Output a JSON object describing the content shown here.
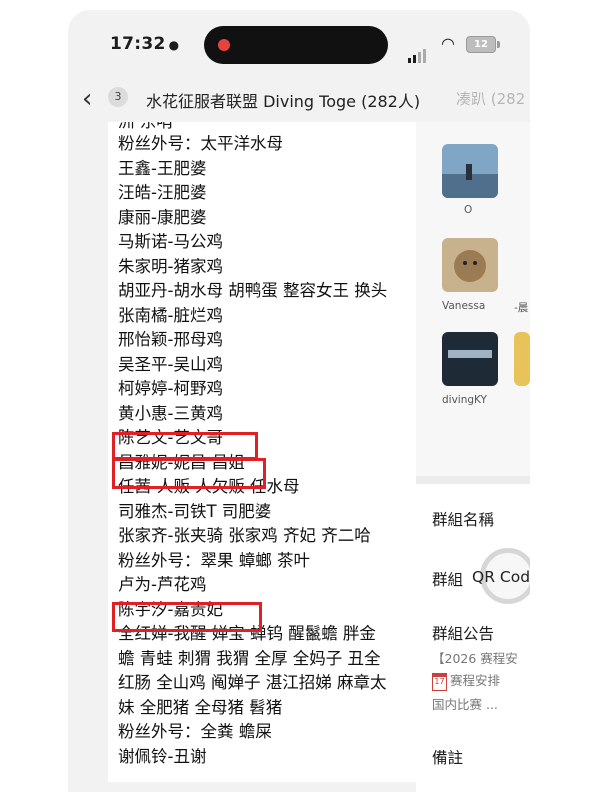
{
  "status": {
    "time": "17:32",
    "battery": "12"
  },
  "header": {
    "back_count": "3",
    "title": "水花征服者联盟 Diving Toge (282人)",
    "overflow": "凑趴 (282"
  },
  "chat": {
    "top_line": "洲 东哨",
    "lines": [
      "粉丝外号：太平洋水母",
      "王鑫-王肥婆",
      "汪皓-汪肥婆",
      "康丽-康肥婆",
      "马斯诺-马公鸡",
      "朱家明-猪家鸡",
      "胡亚丹-胡水母 胡鸭蛋 整容女王 换头",
      "张南橘-脏烂鸡",
      "邢怡颖-邢母鸡",
      "吴圣平-吴山鸡",
      "柯婷婷-柯野鸡",
      "黄小惠-三黄鸡",
      "陈艺文-艺文哥",
      "昌雅妮-妮昌 昌姐",
      "任茜-人贩 人欠贩 任水母",
      "司雅杰-司铁T 司肥婆",
      "张家齐-张夹骑 张家鸡 齐妃 齐二哈",
      "粉丝外号：翠果 蟑螂 茶叶",
      "卢为-芦花鸡",
      "陈宇汐-嘉贵妃",
      "全红婵-我醒 婵宝 蝉钨 醒鬣蟾 胖金",
      "蟾 青蛙 刺猬 我猬 全厚 全妈子 丑全",
      "红肠 全山鸡 阄婵子 湛江招娣 麻章太",
      "妹 全肥猪 全母猪 髫猪",
      "粉丝外号：全粪 蟾屎",
      "谢佩铃-丑谢"
    ]
  },
  "members": [
    {
      "name": "O"
    },
    {
      "name": "Vanessa",
      "extra": "-晨"
    },
    {
      "name": "divingKY"
    }
  ],
  "group_info": {
    "name_label": "群組名稱",
    "qr_label": "群組",
    "qr_text": "QR Cod",
    "notice_label": "群組公告",
    "notice_line1": "【2026 赛程安",
    "notice_line2": "赛程安排",
    "notice_line3": "国内比赛 ...",
    "cal_day": "17",
    "remark_label": "備註"
  },
  "colors": {
    "highlight": "#e01f26",
    "chat_bg": "#ffffff",
    "app_bg": "#f2f2f2"
  }
}
